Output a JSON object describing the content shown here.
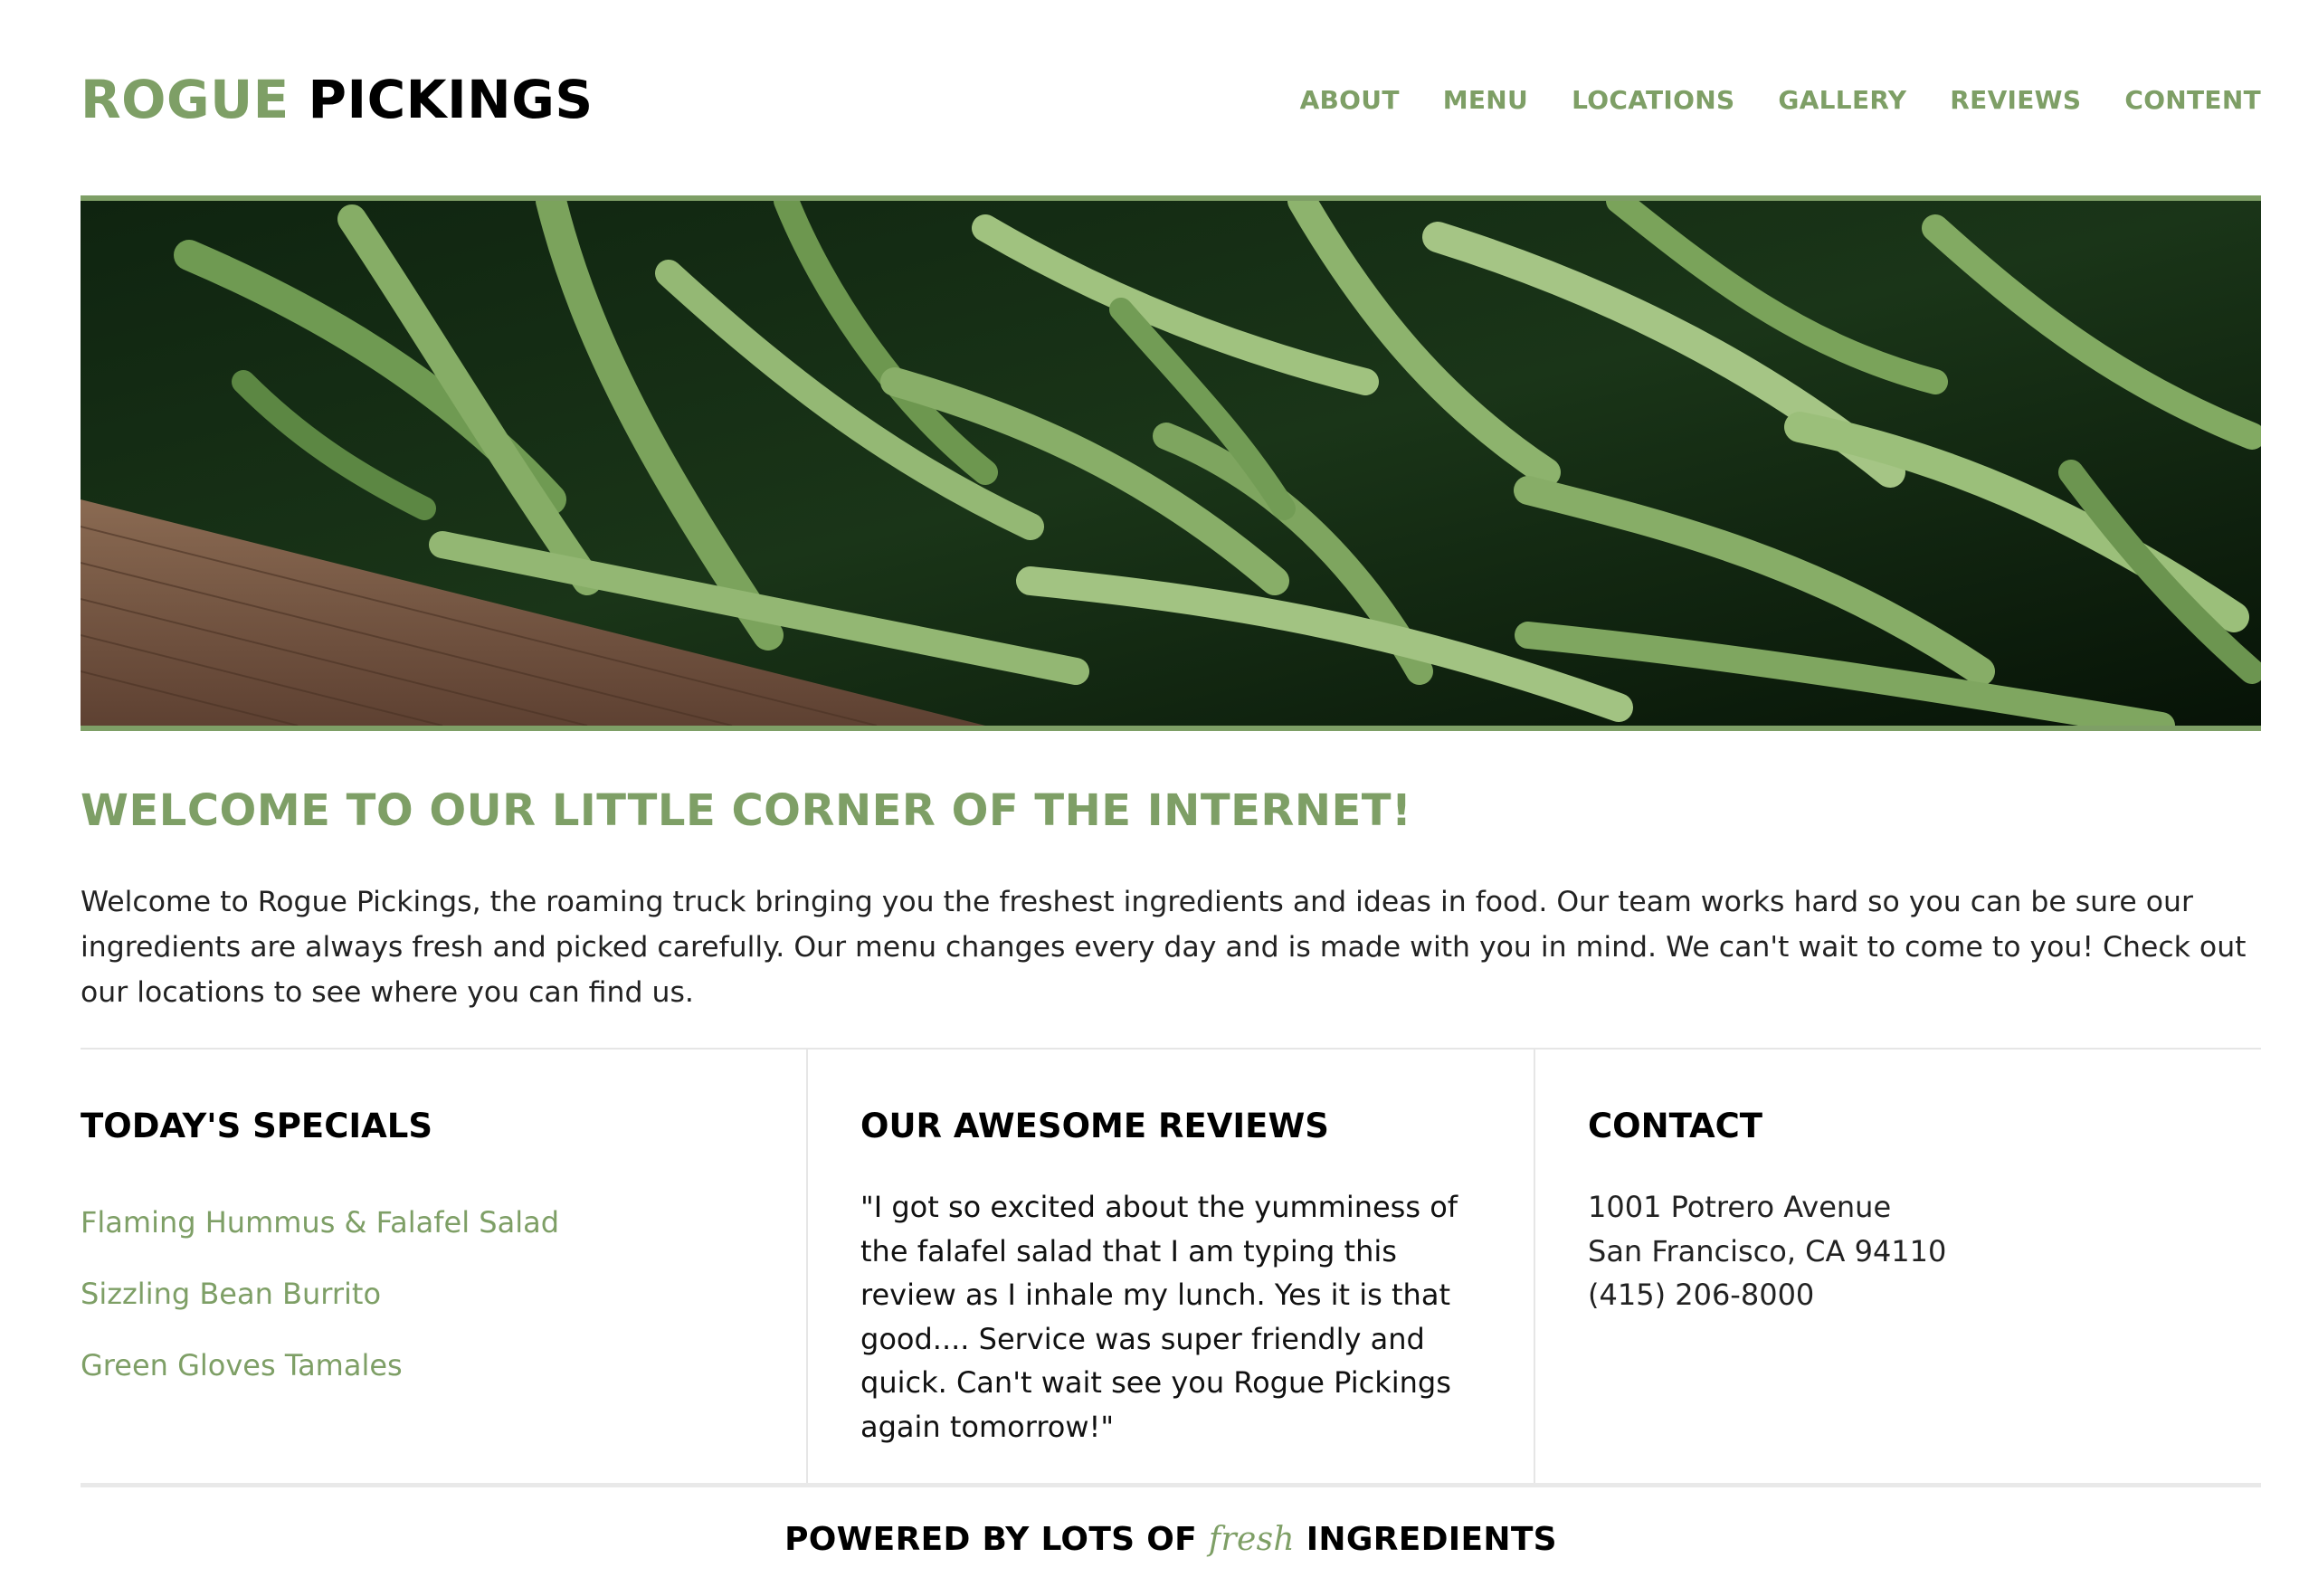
{
  "brand": {
    "name_part1": "ROGUE",
    "name_part2": "PICKINGS",
    "accent_color": "#7e9f66"
  },
  "nav": {
    "items": [
      {
        "label": "ABOUT"
      },
      {
        "label": "MENU"
      },
      {
        "label": "LOCATIONS"
      },
      {
        "label": "GALLERY"
      },
      {
        "label": "REVIEWS"
      },
      {
        "label": "CONTENT"
      }
    ]
  },
  "hero": {
    "image_subject": "green-beans-photo"
  },
  "welcome": {
    "title": "WELCOME TO OUR LITTLE CORNER OF THE INTERNET!",
    "text": "Welcome to Rogue Pickings, the roaming truck bringing you the freshest ingredients and ideas in food. Our team works hard so you can be sure our ingredients are always fresh and picked carefully. Our menu changes every day and is made with you in mind. We can't wait to come to you! Check out our locations to see where you can find us."
  },
  "specials": {
    "title": "TODAY'S SPECIALS",
    "items": [
      {
        "label": "Flaming Hummus & Falafel Salad"
      },
      {
        "label": "Sizzling Bean Burrito"
      },
      {
        "label": "Green Gloves Tamales"
      }
    ]
  },
  "reviews": {
    "title": "OUR AWESOME REVIEWS",
    "quote": "\"I got so excited about the yumminess of the falafel salad that I am typing this review as I inhale my lunch. Yes it is that good.... Service was super friendly and quick. Can't wait see you Rogue Pickings again tomorrow!\""
  },
  "contact": {
    "title": "CONTACT",
    "address_line1": "1001 Potrero Avenue",
    "address_line2": "San Francisco, CA 94110",
    "phone": "(415) 206-8000"
  },
  "footer": {
    "before": "POWERED BY LOTS OF",
    "fresh": "fresh",
    "after": "INGREDIENTS"
  }
}
